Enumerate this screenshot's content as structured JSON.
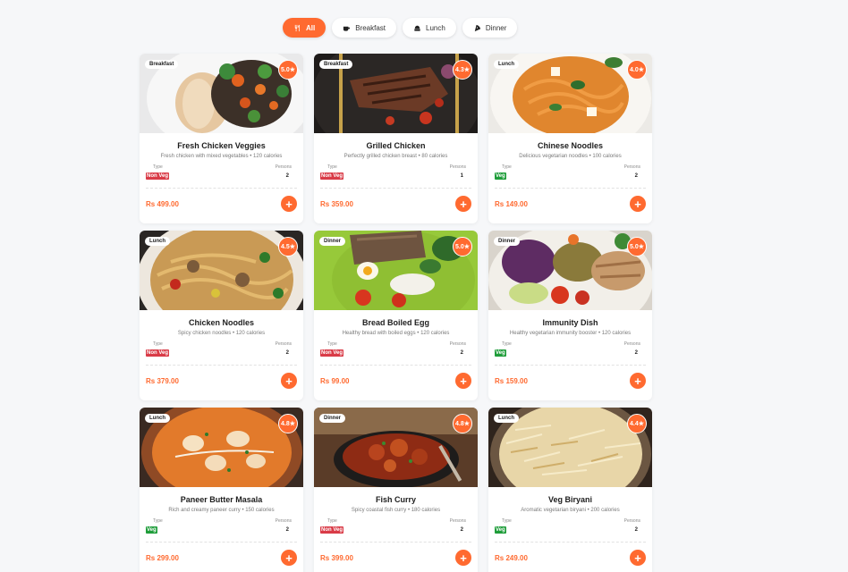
{
  "filters": [
    {
      "label": "All",
      "icon": "cutlery-icon",
      "active": true
    },
    {
      "label": "Breakfast",
      "icon": "coffee-cup-icon",
      "active": false
    },
    {
      "label": "Lunch",
      "icon": "lunch-box-icon",
      "active": false
    },
    {
      "label": "Dinner",
      "icon": "pizza-slice-icon",
      "active": false
    }
  ],
  "labels": {
    "type": "Type",
    "persons": "Persons",
    "add": "+"
  },
  "colors": {
    "accent": "#ff6a30",
    "veg": "#1f9d3a",
    "nonveg": "#d93b47"
  },
  "dishes": [
    {
      "title": "Fresh Chicken Veggies",
      "meal": "Breakfast",
      "rating": "5.0",
      "desc": "Fresh chicken with mixed vegetables • 120 calories",
      "type": "Non Veg",
      "persons": "2",
      "price": "Rs 499.00"
    },
    {
      "title": "Grilled Chicken",
      "meal": "Breakfast",
      "rating": "4.3",
      "desc": "Perfectly grilled chicken breast • 80 calories",
      "type": "Non Veg",
      "persons": "1",
      "price": "Rs 359.00"
    },
    {
      "title": "Chinese Noodles",
      "meal": "Lunch",
      "rating": "4.0",
      "desc": "Delicious vegetarian noodles • 100 calories",
      "type": "Veg",
      "persons": "2",
      "price": "Rs 149.00"
    },
    {
      "title": "Chicken Noodles",
      "meal": "Lunch",
      "rating": "4.5",
      "desc": "Spicy chicken noodles • 120 calories",
      "type": "Non Veg",
      "persons": "2",
      "price": "Rs 379.00"
    },
    {
      "title": "Bread Boiled Egg",
      "meal": "Dinner",
      "rating": "5.0",
      "desc": "Healthy bread with boiled eggs • 120 calories",
      "type": "Non Veg",
      "persons": "2",
      "price": "Rs 99.00"
    },
    {
      "title": "Immunity Dish",
      "meal": "Dinner",
      "rating": "5.0",
      "desc": "Healthy vegetarian immunity booster • 120 calories",
      "type": "Veg",
      "persons": "2",
      "price": "Rs 159.00"
    },
    {
      "title": "Paneer Butter Masala",
      "meal": "Lunch",
      "rating": "4.8",
      "desc": "Rich and creamy paneer curry • 150 calories",
      "type": "Veg",
      "persons": "2",
      "price": "Rs 299.00"
    },
    {
      "title": "Fish Curry",
      "meal": "Dinner",
      "rating": "4.8",
      "desc": "Spicy coastal fish curry • 180 calories",
      "type": "Non Veg",
      "persons": "2",
      "price": "Rs 399.00"
    },
    {
      "title": "Veg Biryani",
      "meal": "Lunch",
      "rating": "4.4",
      "desc": "Aromatic vegetarian biryani • 200 calories",
      "type": "Veg",
      "persons": "2",
      "price": "Rs 249.00"
    }
  ]
}
